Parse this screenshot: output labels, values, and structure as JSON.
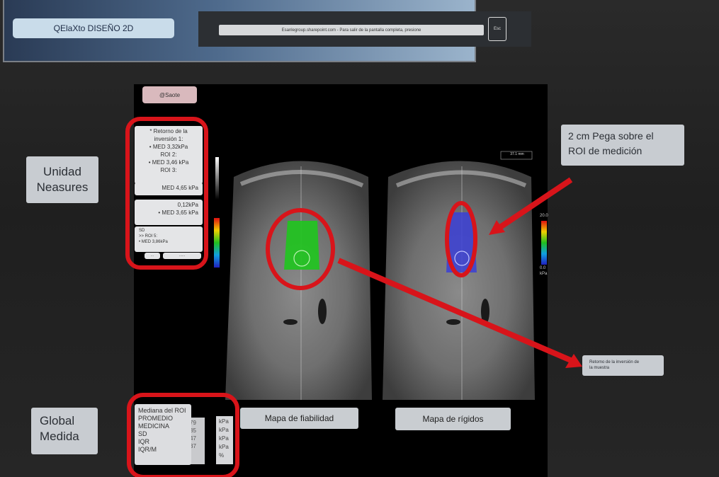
{
  "banner": {
    "title": "QElaXto DISEÑO 2D",
    "fullscreen_notice": "Esanlegroup.sharepoint.com - Para salir de la pantalla completa, presione",
    "esc_label": "Esc"
  },
  "brand_tag": "@Saote",
  "measure_card": {
    "lines": [
      "* Retorno de la",
      "inversión 1:",
      "• MED 3,32kPa",
      "ROI 2:",
      "• MED 3,46 kPa",
      "ROI 3:"
    ],
    "row2": "MED 4,65 kPa",
    "row3": [
      "0,12kPa",
      "• MED 3,65 kPa"
    ],
    "row4": [
      "SD",
      ">> ROI 5:",
      "• MED 3,86kPa"
    ],
    "footer_left": "...",
    "footer_right": "......"
  },
  "side_labels": {
    "unidad": [
      "Unidad",
      "Neasures"
    ],
    "global": [
      "Global",
      "Medida"
    ],
    "roi_note": [
      "2 cm Pega sobre el",
      "ROI de medición"
    ],
    "retorno": [
      "Retorno de la inversión de",
      "la muestra"
    ],
    "mapa_fiabilidad": "Mapa de fiabilidad",
    "mapa_rigidos": "Mapa de rígidos"
  },
  "scale_readout": "37.1 mm",
  "colorbar": {
    "top": "20.0",
    "bottom": "0.0",
    "unit": "kPa"
  },
  "summary_table": {
    "rows": [
      "Mediana del ROI",
      "PROMEDIO",
      "MEDICINA",
      "SD",
      "IQR",
      "IQR/M"
    ],
    "values": [
      "79",
      "35",
      "47",
      "37"
    ],
    "units": [
      "kPa",
      "kPa",
      "kPa",
      "kPa",
      "%"
    ]
  },
  "colors": {
    "annotation_red": "#d8141a",
    "reliability_green": "#21c41f",
    "stiffness_blue": "#3b3fd6"
  }
}
